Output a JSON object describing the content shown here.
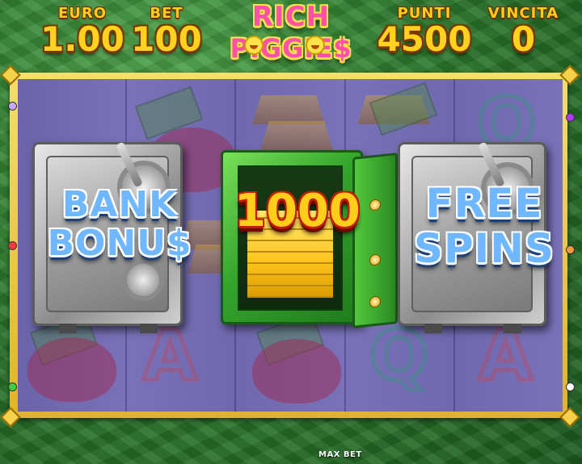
{
  "header": {
    "euro_label": "EURO",
    "euro_value": "1.00",
    "bet_label": "BET",
    "bet_value": "100",
    "points_label": "PUNTI",
    "points_value": "4500",
    "win_label": "VINCITA",
    "win_value": "0"
  },
  "logo": {
    "line1": "RICH",
    "line2": "PIGGIE$"
  },
  "reels": {
    "left_feature_line1": "BANK",
    "left_feature_line2": "BONU$",
    "center_amount": "1000",
    "right_feature_line1": "FREE",
    "right_feature_line2": "SPINS",
    "background_symbols": [
      "A",
      "Q",
      "A",
      "Q",
      "A",
      "A"
    ]
  },
  "footer": {
    "max_bet_label": "MAX BET"
  },
  "colors": {
    "frame_gold": "#f6de6a",
    "reel_bg": "#7a72b8",
    "value_yellow": "#ffd21e",
    "logo_pink": "#ff4fa8",
    "feature_blue": "#6fb8ff",
    "safe_green": "#34a42c"
  },
  "icons": [
    "pig-face-icon",
    "safe-icon",
    "green-open-safe-icon",
    "gold-bars-icon",
    "cash-stack-icon",
    "piggy-purse-icon",
    "frame-corner-icon",
    "line-gem-icon"
  ]
}
